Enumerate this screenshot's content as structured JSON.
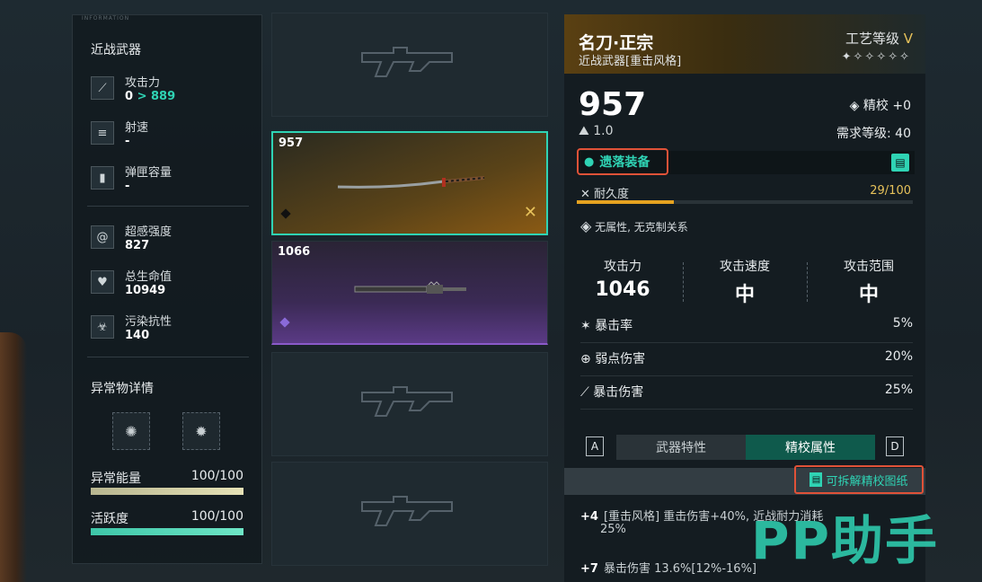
{
  "stats_panel": {
    "info_tag": "INFORMATION",
    "title": "近战武器",
    "rows": [
      {
        "label": "攻击力",
        "value": "0",
        "upgrade": "> 889",
        "icon": "blade-icon"
      },
      {
        "label": "射速",
        "value": "-",
        "icon": "fire-rate-icon"
      },
      {
        "label": "弹匣容量",
        "value": "-",
        "icon": "magazine-icon"
      }
    ],
    "rows2": [
      {
        "label": "超感强度",
        "value": "827",
        "icon": "spiral-icon"
      },
      {
        "label": "总生命值",
        "value": "10949",
        "icon": "heart-icon"
      },
      {
        "label": "污染抗性",
        "value": "140",
        "icon": "biohazard-icon"
      }
    ],
    "anomaly_title": "异常物详情",
    "anomaly_energy_label": "异常能量",
    "anomaly_energy_value": "100/100",
    "activity_label": "活跃度",
    "activity_value": "100/100",
    "anomaly_energy_fill": 1.0,
    "activity_fill": 1.0
  },
  "weapon_list": {
    "slots": [
      {
        "num": ""
      },
      {
        "num": "957"
      },
      {
        "num": "1066"
      },
      {
        "num": ""
      },
      {
        "num": ""
      }
    ]
  },
  "detail": {
    "name": "名刀·正宗",
    "type": "近战武器[重击风格]",
    "craft_label": "工艺等级",
    "craft_level": "V",
    "stars": "✦✧✧✧✧✧",
    "power": "957",
    "weight": "1.0",
    "refine": "精校 +0",
    "required_level": "需求等级: 40",
    "equip_label": "遗落装备",
    "durability_label": "耐久度",
    "durability_value": "29/100",
    "durability_fill": 0.29,
    "attribute_note": "无属性, 无克制关系",
    "main_stats": [
      {
        "label": "攻击力",
        "value": "1046"
      },
      {
        "label": "攻击速度",
        "value": "中"
      },
      {
        "label": "攻击范围",
        "value": "中"
      }
    ],
    "sub_stats": [
      {
        "label": "暴击率",
        "value": "5%",
        "icon": "crit-icon"
      },
      {
        "label": "弱点伤害",
        "value": "20%",
        "icon": "weakpoint-icon"
      },
      {
        "label": "暴击伤害",
        "value": "25%",
        "icon": "crit-damage-icon"
      }
    ],
    "key_left": "A",
    "key_right": "D",
    "tab_traits": "武器特性",
    "tab_refine": "精校属性",
    "blueprint_label": "可拆解精校图纸",
    "perk1_tag": "+4",
    "perk1_text": "[重击风格] 重击伤害+40%, 近战耐力消耗",
    "perk1_text2": "25%",
    "perk2_tag": "+7",
    "perk2_text": "暴击伤害 13.6%[12%-16%]"
  },
  "watermark": "PP助手",
  "colors": {
    "accent": "#2fd3b4",
    "highlight_border": "#e05238",
    "gold": "#e6c15a"
  }
}
